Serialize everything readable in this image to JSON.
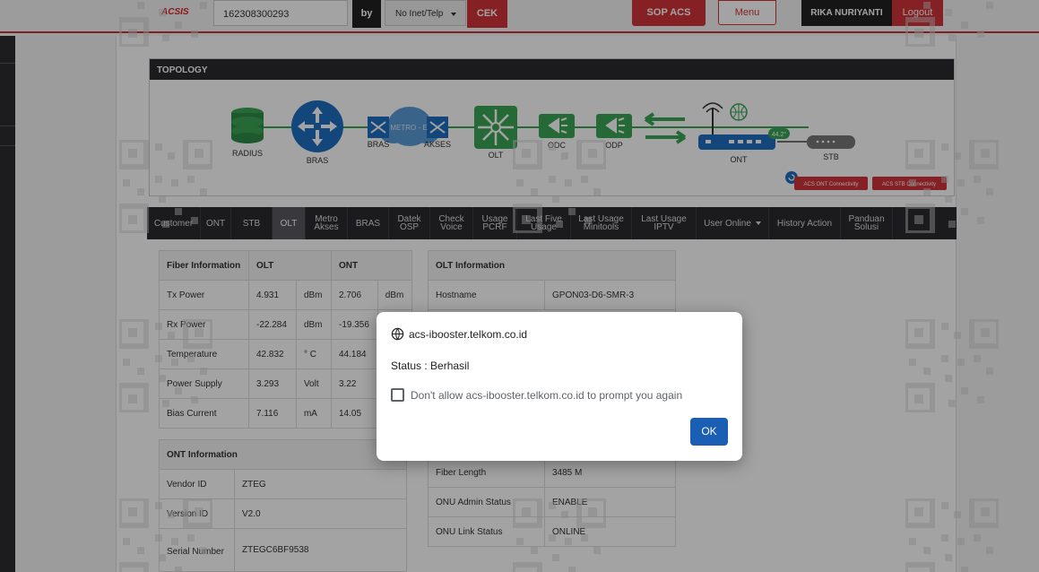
{
  "header": {
    "logo": "ACSIS",
    "search_value": "162308300293",
    "by_label": "by",
    "search_type": "No Inet/Telp",
    "cek_label": "CEK",
    "sop_label": "SOP ACS",
    "menu_label": "Menu",
    "user_name": "RIKA NURIYANTI",
    "logout_label": "Logout"
  },
  "topology": {
    "title": "TOPOLOGY",
    "nodes": {
      "radius": "RADIUS",
      "bras": "BRAS",
      "bras2": "BRAS",
      "metro": "METRO - E",
      "akses": "AKSES",
      "olt": "OLT",
      "odc": "ODC",
      "odp": "ODP",
      "ont": "ONT",
      "stb": "STB",
      "ont_signal": "44.2°"
    },
    "buttons": {
      "ont_conn": "ACS ONT Connectivity",
      "stb_conn": "ACS STB Connectivity"
    }
  },
  "tabs": [
    {
      "label": "Customer"
    },
    {
      "label": "ONT"
    },
    {
      "label": "STB"
    },
    {
      "label": "OLT"
    },
    {
      "label": "Metro Akses"
    },
    {
      "label": "BRAS"
    },
    {
      "label": "Datek OSP"
    },
    {
      "label": "Check Voice"
    },
    {
      "label": "Usage PCRF"
    },
    {
      "label": "Last Five Usage"
    },
    {
      "label": "Last Usage Minitools"
    },
    {
      "label": "Last Usage IPTV"
    },
    {
      "label": "User Online"
    },
    {
      "label": "History Action"
    },
    {
      "label": "Panduan Solusi"
    }
  ],
  "fiber": {
    "headers": [
      "Fiber Information",
      "OLT",
      "ONT"
    ],
    "rows": [
      {
        "label": "Tx Power",
        "olt": "4.931",
        "olt_unit": "dBm",
        "ont": "2.706",
        "ont_unit": "dBm"
      },
      {
        "label": "Rx Power",
        "olt": "-22.284",
        "olt_unit": "dBm",
        "ont": "-19.356",
        "ont_unit": ""
      },
      {
        "label": "Temperature",
        "olt": "42.832",
        "olt_unit": "° C",
        "ont": "44.184",
        "ont_unit": ""
      },
      {
        "label": "Power Supply",
        "olt": "3.293",
        "olt_unit": "Volt",
        "ont": "3.22",
        "ont_unit": ""
      },
      {
        "label": "Bias Current",
        "olt": "7.116",
        "olt_unit": "mA",
        "ont": "14.05",
        "ont_unit": ""
      }
    ]
  },
  "olt_info": {
    "title": "OLT Information",
    "hostname_label": "Hostname",
    "hostname": "GPON03-D6-SMR-3",
    "fiber_length_label": "Fiber Length",
    "fiber_length": "3485 M",
    "admin_status_label": "ONU Admin Status",
    "admin_status": "ENABLE",
    "link_status_label": "ONU Link Status",
    "link_status": "ONLINE"
  },
  "ont_info": {
    "title": "ONT Information",
    "vendor_label": "Vendor ID",
    "vendor": "ZTEG",
    "version_label": "Version ID",
    "version": "V2.0",
    "serial_label": "Serial Number",
    "serial": "ZTEGC6BF9538"
  },
  "dialog": {
    "origin": "acs-ibooster.telkom.co.id",
    "message": "Status : Berhasil",
    "checkbox_label": "Don't allow acs-ibooster.telkom.co.id to prompt you again",
    "ok_label": "OK"
  },
  "colors": {
    "accent": "#d1343b",
    "dark": "#2b2b30",
    "node_blue": "#1f6fc1",
    "node_green": "#3aa655",
    "dialog_button": "#1a5fb4"
  }
}
